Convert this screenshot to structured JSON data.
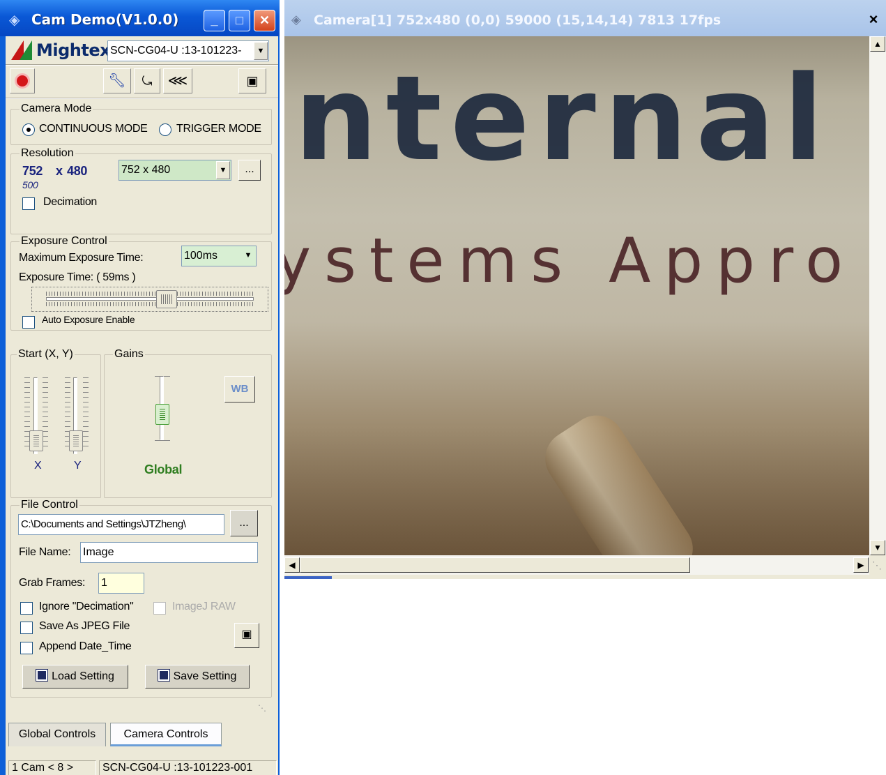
{
  "control_window": {
    "title": "Cam Demo(V1.0.0)",
    "brand": "Mightex",
    "device_select": "SCN-CG04-U  :13-101223-",
    "camera_mode": {
      "caption": "Camera Mode",
      "continuous_label": "CONTINUOUS MODE",
      "trigger_label": "TRIGGER MODE",
      "selected": "continuous"
    },
    "resolution": {
      "caption": "Resolution",
      "width": "752",
      "x": "x",
      "height": "480",
      "sub": "500",
      "select": "752 x 480",
      "more": "...",
      "decimation_label": "Decimation"
    },
    "exposure": {
      "caption": "Exposure Control",
      "max_label": "Maximum  Exposure Time:",
      "max_value": "100ms",
      "time_label": "Exposure Time: ( 59ms )",
      "slider_level": 0.59,
      "auto_label": "Auto Exposure Enable"
    },
    "start": {
      "caption": "Start (X, Y)",
      "x_label": "X",
      "y_label": "Y"
    },
    "gains": {
      "caption": "Gains",
      "global_label": "Global",
      "wb_label": "WB"
    },
    "file_control": {
      "caption": "File Control",
      "path": "C:\\Documents and Settings\\JTZheng\\",
      "browse": "...",
      "name_label": "File Name:",
      "name_value": "Image",
      "grab_label": "Grab Frames:",
      "grab_value": "1",
      "ignore_label": "Ignore \"Decimation\"",
      "imagej_label": "ImageJ RAW",
      "jpeg_label": "Save As JPEG File",
      "append_label": "Append Date_Time",
      "load_label": "Load Setting",
      "save_label": "Save Setting"
    },
    "tabs": [
      "Global Controls",
      "Camera Controls"
    ],
    "status": [
      "1 Cam < 8 >",
      "SCN-CG04-U  :13-101223-001"
    ]
  },
  "camera_window": {
    "title": "Camera[1]   752x480 (0,0) 59000 (15,14,14) 7813 17fps",
    "close": "×",
    "image_text_line1": "nternal",
    "image_text_line2": "ystems Appro"
  },
  "colors": {
    "xp_blue": "#0d5fd8",
    "face": "#ece9d8",
    "brand_dark": "#0c2b6c",
    "global_green": "#2e7d1f",
    "res_blue": "#1a237e"
  }
}
